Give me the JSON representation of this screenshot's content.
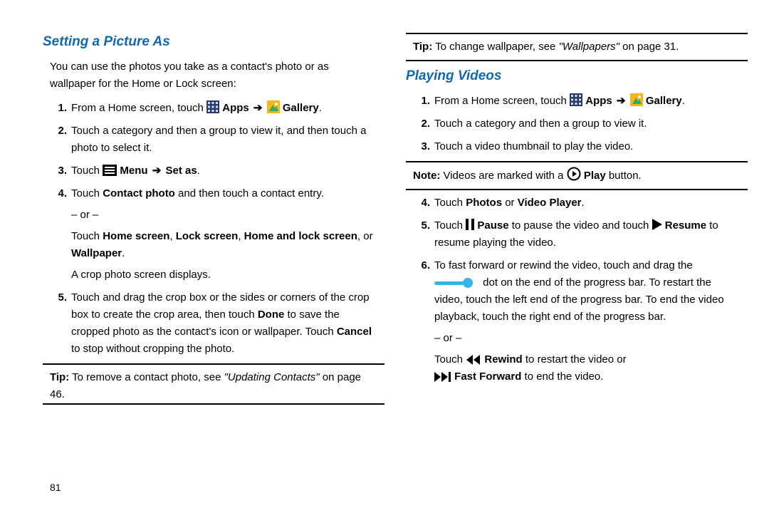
{
  "page_number": "81",
  "left": {
    "title": "Setting a Picture As",
    "intro": "You can use the photos you take as a contact's photo or as wallpaper for the Home or Lock screen:",
    "steps": {
      "s1_pre": "From a Home screen, touch ",
      "s1_apps": "Apps",
      "s1_gallery": "Gallery",
      "s2": "Touch a category and then a group to view it, and then touch a photo to select it.",
      "s3_pre": "Touch ",
      "s3_menu": "Menu",
      "s3_setas": "Set as",
      "s4_a_pre": "Touch ",
      "s4_a_contactphoto": "Contact photo",
      "s4_a_post": " and then touch a contact entry.",
      "s4_or": "– or –",
      "s4_b_pre": "Touch ",
      "s4_b_opt1": "Home screen",
      "s4_b_opt2": "Lock screen",
      "s4_b_opt3": "Home and lock screen",
      "s4_b_or": ", or ",
      "s4_b_opt4": "Wallpaper",
      "s4_b_post": ".",
      "s4_c": "A crop photo screen displays.",
      "s5_1": "Touch and drag the crop box or the sides or corners of the crop box to create the crop area, then touch ",
      "s5_done": "Done",
      "s5_2": " to save the cropped photo as the contact's icon or wallpaper. Touch ",
      "s5_cancel": "Cancel",
      "s5_3": " to stop without cropping the photo."
    },
    "tip_label": "Tip:",
    "tip_1": " To remove a contact photo, see ",
    "tip_ref": "\"Updating Contacts\"",
    "tip_2": " on page 46."
  },
  "right": {
    "top_tip_label": "Tip:",
    "top_tip_1": " To change wallpaper, see ",
    "top_tip_ref": "\"Wallpapers\"",
    "top_tip_2": " on page 31.",
    "title": "Playing Videos",
    "steps": {
      "s1_pre": "From a Home screen, touch ",
      "s1_apps": "Apps",
      "s1_gallery": "Gallery",
      "s2": "Touch a category and then a group to view it.",
      "s3": "Touch a video thumbnail to play the video."
    },
    "note_label": "Note:",
    "note_1": " Videos are marked with a ",
    "note_play": "Play",
    "note_2": " button.",
    "steps2": {
      "s4_pre": "Touch ",
      "s4_photos": "Photos",
      "s4_or": " or ",
      "s4_video_player": "Video Player",
      "s4_post": ".",
      "s5_1": "Touch ",
      "s5_pause": "Pause",
      "s5_2": " to pause the video and touch ",
      "s5_resume": "Resume",
      "s5_3": " to resume playing the video.",
      "s6_1": "To fast forward or rewind the video, touch and drag the ",
      "s6_2": "dot on the end of the progress bar. To restart the video, touch the left end of the progress bar. To end the video playback, touch the right end of the progress bar.",
      "s6_or": "– or –",
      "s6_3a": "Touch ",
      "s6_rewind": "Rewind",
      "s6_3b": " to restart the video or ",
      "s6_ff": "Fast Forward",
      "s6_3c": " to end the video."
    }
  }
}
